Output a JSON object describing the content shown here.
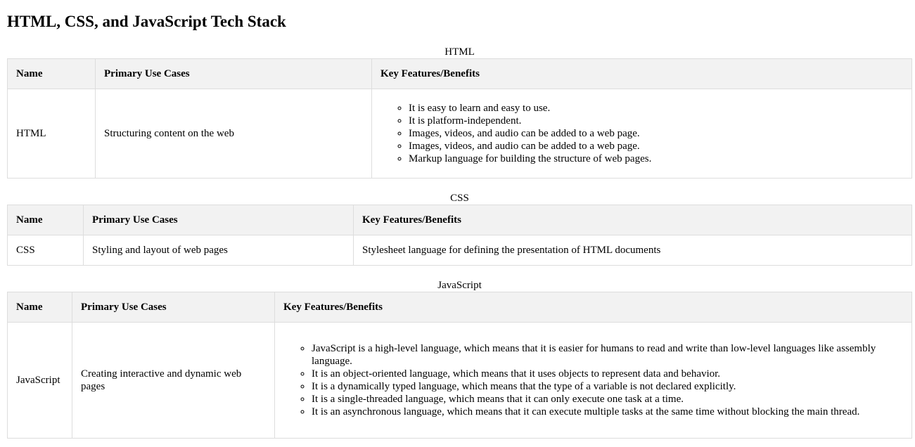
{
  "page": {
    "title": "HTML, CSS, and JavaScript Tech Stack"
  },
  "headers": {
    "name": "Name",
    "use_cases": "Primary Use Cases",
    "features": "Key Features/Benefits"
  },
  "html_section": {
    "caption": "HTML",
    "name": "HTML",
    "use_cases": "Structuring content on the web",
    "features": [
      "It is easy to learn and easy to use.",
      "It is platform-independent.",
      "Images, videos, and audio can be added to a web page.",
      "Images, videos, and audio can be added to a web page.",
      "Markup language for building the structure of web pages."
    ]
  },
  "css_section": {
    "caption": "CSS",
    "name": "CSS",
    "use_cases": "Styling and layout of web pages",
    "features_text": "Stylesheet language for defining the presentation of HTML documents"
  },
  "js_section": {
    "caption": "JavaScript",
    "name": "JavaScript",
    "use_cases": "Creating interactive and dynamic web pages",
    "features": [
      "JavaScript is a high-level language, which means that it is easier for humans to read and write than low-level languages like assembly language.",
      "It is an object-oriented language, which means that it uses objects to represent data and behavior.",
      "It is a dynamically typed language, which means that the type of a variable is not declared explicitly.",
      "It is a single-threaded language, which means that it can only execute one task at a time.",
      "It is an asynchronous language, which means that it can execute multiple tasks at the same time without blocking the main thread."
    ]
  }
}
